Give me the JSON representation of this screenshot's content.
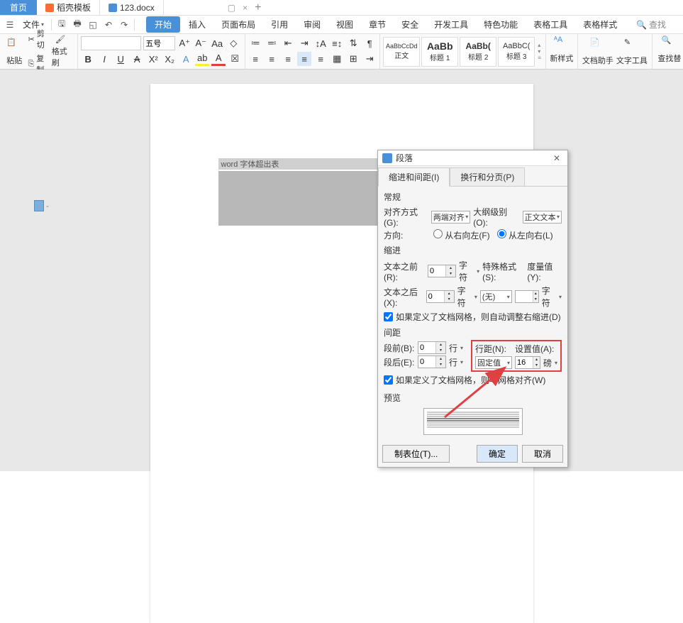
{
  "tabs": {
    "home": "首页",
    "templates": "稻壳模板",
    "document": "123.docx",
    "close_x": "×",
    "window_close": "×",
    "restore": "▢",
    "new_tab": "+"
  },
  "menu": {
    "file": "文件",
    "search_placeholder": "查找"
  },
  "ribbon_tabs": {
    "start": "开始",
    "insert": "插入",
    "page_layout": "页面布局",
    "references": "引用",
    "review": "审阅",
    "view": "视图",
    "sections": "章节",
    "security": "安全",
    "dev_tools": "开发工具",
    "special": "特色功能",
    "table_tools": "表格工具",
    "table_style": "表格样式"
  },
  "toolbar": {
    "paste": "粘贴",
    "cut": "剪切",
    "copy": "复制",
    "format_painter": "格式刷",
    "font_size_value": "五号",
    "styles": {
      "normal": {
        "preview": "AaBbCcDd",
        "label": "正文"
      },
      "h1": {
        "preview": "AaBb",
        "label": "标题 1"
      },
      "h2": {
        "preview": "AaBb(",
        "label": "标题 2"
      },
      "h3": {
        "preview": "AaBbC(",
        "label": "标题 3"
      }
    },
    "new_style": "新样式",
    "doc_helper": "文档助手",
    "text_tools": "文字工具",
    "find_replace": "查找替"
  },
  "document": {
    "line_text": "word 字体超出表"
  },
  "dialog": {
    "title": "段落",
    "tab_indent": "缩进和间距(I)",
    "tab_breaks": "换行和分页(P)",
    "section_general": "常规",
    "alignment_label": "对齐方式(G):",
    "alignment_value": "两端对齐",
    "outline_label": "大纲级别(O):",
    "outline_value": "正文文本",
    "direction_label": "方向:",
    "direction_rtl": "从右向左(F)",
    "direction_ltr": "从左向右(L)",
    "section_indent": "缩进",
    "before_text_label": "文本之前(R):",
    "after_text_label": "文本之后(X):",
    "indent_unit": "字符",
    "special_format_label": "特殊格式(S):",
    "special_value": "(无)",
    "measure_label": "度量值(Y):",
    "measure_unit": "字符",
    "auto_adjust_indent": "如果定义了文档网格，则自动调整右缩进(D)",
    "section_spacing": "间距",
    "before_para_label": "段前(B):",
    "after_para_label": "段后(E):",
    "spacing_unit": "行",
    "line_spacing_label": "行距(N):",
    "line_spacing_value": "固定值",
    "setting_label": "设置值(A):",
    "setting_value": "16",
    "setting_unit": "磅",
    "align_grid": "如果定义了文档网格，则与网格对齐(W)",
    "section_preview": "预览",
    "tab_stops_btn": "制表位(T)...",
    "ok_btn": "确定",
    "cancel_btn": "取消",
    "spinner_zero": "0"
  }
}
